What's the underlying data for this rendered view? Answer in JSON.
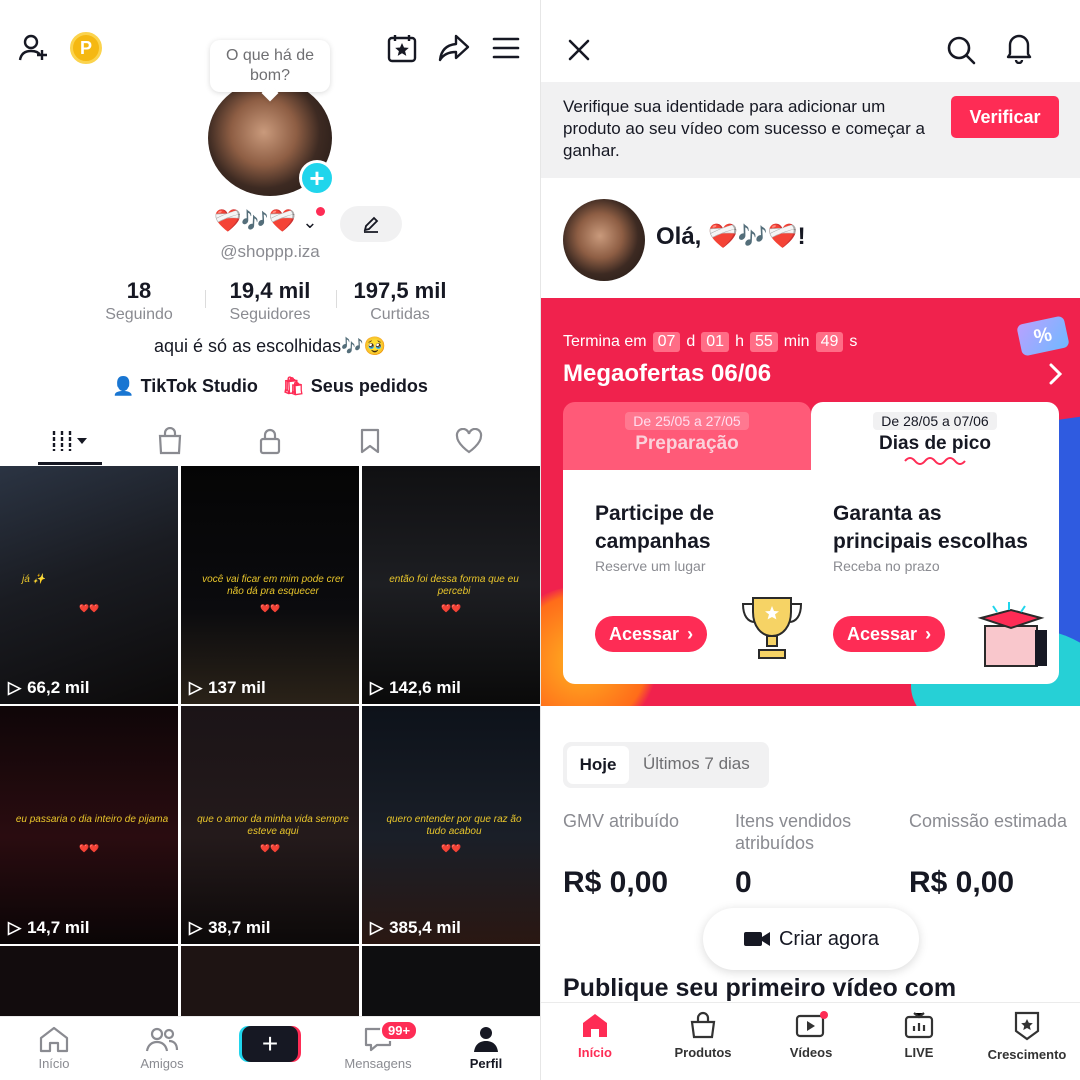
{
  "left": {
    "bubble_text": "O que há de bom?",
    "coin_label": "P",
    "nickname": "❤️‍🩹🎶❤️‍🩹",
    "handle": "@shoppp.iza",
    "stats": [
      {
        "value": "18",
        "label": "Seguindo"
      },
      {
        "value": "19,4 mil",
        "label": "Seguidores"
      },
      {
        "value": "197,5 mil",
        "label": "Curtidas"
      }
    ],
    "bio": "aqui é só as escolhidas🎶🥹",
    "links": {
      "studio": "TikTok Studio",
      "orders": "Seus pedidos"
    },
    "videos": [
      {
        "caption": "já ✨",
        "views": "66,2 mil"
      },
      {
        "caption": "você vai ficar em mim pode crer não dá pra esquecer",
        "views": "137 mil"
      },
      {
        "caption": "então foi dessa forma que eu percebi",
        "views": "142,6 mil"
      },
      {
        "caption": "eu passaria o dia inteiro de pijama",
        "views": "14,7 mil"
      },
      {
        "caption": "que o amor da minha vida sempre esteve aqui",
        "views": "38,7 mil"
      },
      {
        "caption": "quero entender por que raz ão tudo acabou",
        "views": "385,4 mil"
      }
    ],
    "hearts": "❤️❤️",
    "nav": {
      "home": "Início",
      "friends": "Amigos",
      "messages": "Mensagens",
      "profile": "Perfil",
      "messages_badge": "99+"
    }
  },
  "right": {
    "notice_text": "Verifique sua identidade para adicionar um produto ao seu vídeo com sucesso e começar a ganhar.",
    "verify_label": "Verificar",
    "greeting": "Olá, ❤️‍🩹🎶❤️‍🩹!",
    "promo": {
      "ends_label": "Termina em",
      "days": "07",
      "days_unit": "d",
      "hours": "01",
      "hours_unit": "h",
      "minutes": "55",
      "minutes_unit": "min",
      "seconds": "49",
      "seconds_unit": "s",
      "title": "Megaofertas 06/06",
      "badge": "%",
      "tab_prep": {
        "dates": "De 25/05 a 27/05",
        "label": "Preparação"
      },
      "tab_peak": {
        "dates": "De 28/05 a 07/06",
        "label": "Dias de pico"
      },
      "left_card": {
        "title": "Participe de campanhas",
        "subtitle": "Reserve um lugar",
        "button": "Acessar"
      },
      "right_card": {
        "title": "Garanta as principais escolhas",
        "subtitle": "Receba no prazo",
        "button": "Acessar"
      }
    },
    "segment": {
      "today": "Hoje",
      "week": "Últimos 7 dias"
    },
    "metrics": [
      {
        "label": "GMV atribuído",
        "value": "R$ 0,00"
      },
      {
        "label": "Itens vendidos atribuídos",
        "value": "0"
      },
      {
        "label": "Comissão estimada",
        "value": "R$ 0,00"
      }
    ],
    "create_now": "Criar agora",
    "publish_title": "Publique seu primeiro vídeo com",
    "nav": {
      "home": "Início",
      "products": "Produtos",
      "videos": "Vídeos",
      "live": "LIVE",
      "growth": "Crescimento"
    }
  },
  "colors": {
    "brand_red": "#fe2c55",
    "teal": "#20d5ec",
    "promo_bg": "#f0224d"
  }
}
